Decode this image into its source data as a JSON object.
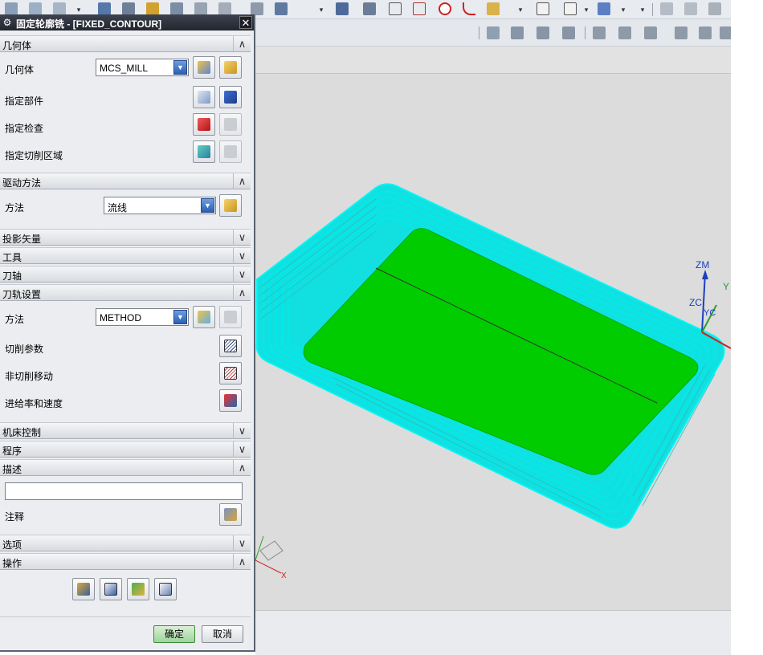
{
  "window": {
    "title": "固定轮廓铣 - [FIXED_CONTOUR]",
    "close_glyph": "✕",
    "settings_icon": "gear-icon"
  },
  "sections": {
    "geometry": {
      "header": "几何体",
      "expanded": true,
      "geometry_label": "几何体",
      "geometry_value": "MCS_MILL",
      "part_label": "指定部件",
      "check_label": "指定检查",
      "cut_area_label": "指定切削区域"
    },
    "drive_method": {
      "header": "驱动方法",
      "expanded": true,
      "method_label": "方法",
      "method_value": "流线"
    },
    "projection_vector": {
      "header": "投影矢量",
      "expanded": false
    },
    "tool": {
      "header": "工具",
      "expanded": false
    },
    "tool_axis": {
      "header": "刀轴",
      "expanded": false
    },
    "path_settings": {
      "header": "刀轨设置",
      "expanded": true,
      "method_label": "方法",
      "method_value": "METHOD",
      "cut_params_label": "切削参数",
      "non_cut_moves_label": "非切削移动",
      "feeds_speeds_label": "进给率和速度"
    },
    "machine_control": {
      "header": "机床控制",
      "expanded": false
    },
    "program": {
      "header": "程序",
      "expanded": false
    },
    "description": {
      "header": "描述",
      "expanded": true,
      "text_value": "",
      "note_label": "注释"
    },
    "options": {
      "header": "选项",
      "expanded": false
    },
    "actions": {
      "header": "操作",
      "expanded": true
    }
  },
  "buttons": {
    "ok": "确定",
    "cancel": "取消"
  },
  "viewport": {
    "axis_labels": {
      "zm": "ZM",
      "zc": "ZC",
      "yc": "YC",
      "ym": "Y",
      "xc": "X"
    }
  },
  "colors": {
    "toolpath": "#00f0f0",
    "cut_area": "#00cc00",
    "axis_blue": "#1c3fbf",
    "dialog_title": "#2b2f38"
  }
}
